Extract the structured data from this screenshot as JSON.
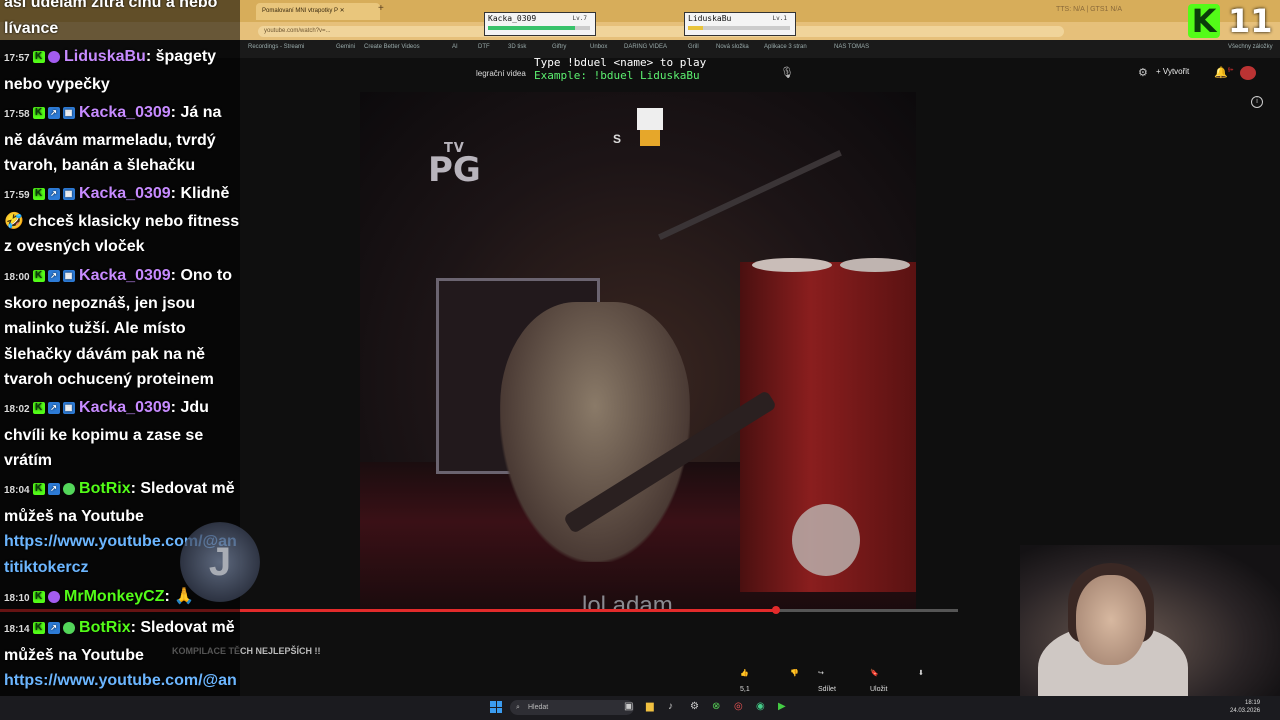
{
  "browser": {
    "active_tab": "Pomalovaní MNI vtrapotky P",
    "url": "youtube.com/watch?v=...",
    "window_status": "TTS: N/A | GTS1 N/A",
    "bookmarks": [
      "Recordings - Streami",
      "Gemini",
      "Create Better Videos",
      "AI",
      "DTF",
      "3D tisk",
      "Giftry",
      "Unbox",
      "DARING VIDEA",
      "Grill",
      "Nová složka",
      "Aplikace 3 stran",
      "NAS TOMAS",
      "Všechny záložky"
    ]
  },
  "youtube": {
    "search_suggestion": "legrační videa",
    "create_label": "Vytvořit",
    "notification_count": "9+",
    "video_title": "KOMPILACE TĚCH NEJLEPŠÍCH !!",
    "like_count": "5,1 tis.",
    "share_label": "Sdílet",
    "save_label": "Uložit",
    "progress": 0.81,
    "watermark": "lol adam",
    "rating_tv": "TV",
    "rating_pg": "PG"
  },
  "duel": {
    "instruction": "Type !bduel <name> to play",
    "example": "Example: !bduel LiduskaBu",
    "players": [
      {
        "name": "Kacka_0309",
        "level": "Lv.7",
        "hp": 0.85,
        "color": "#38c26a"
      },
      {
        "name": "LiduskaBu",
        "level": "Lv.1",
        "hp": 0.15,
        "color": "#e8c33a"
      }
    ],
    "sprite_label": "S"
  },
  "kick": {
    "badge_letter": "K",
    "count": "11"
  },
  "chat": {
    "messages": [
      {
        "ts": "",
        "user": "",
        "text": "asi udělám zítra cînu a nebo lívance"
      },
      {
        "ts": "17:57",
        "user": "LiduskaBu",
        "user_color": "#c78bff",
        "text": ": špagety nebo vypečky"
      },
      {
        "ts": "17:58",
        "user": "Kacka_0309",
        "user_color": "#c78bff",
        "text": ": Já na ně dávám marmeladu, tvrdý tvaroh, banán a šlehačku"
      },
      {
        "ts": "17:59",
        "user": "Kacka_0309",
        "user_color": "#c78bff",
        "text": ": Klidně 🤣 chceš klasicky nebo fitness z ovesných vloček"
      },
      {
        "ts": "18:00",
        "user": "Kacka_0309",
        "user_color": "#c78bff",
        "text": ": Ono to skoro nepoznáš, jen jsou malinko tužší. Ale místo šlehačky dávám pak na ně tvaroh ochucený proteinem"
      },
      {
        "ts": "18:02",
        "user": "Kacka_0309",
        "user_color": "#c78bff",
        "text": ": Jdu chvíli ke kopimu a zase se vrátím"
      },
      {
        "ts": "18:04",
        "user": "BotRix",
        "user_color": "#53fc18",
        "text": ": Sledovat mě můžeš na Youtube",
        "link": "https://www.youtube.com/@antitiktokercz"
      },
      {
        "ts": "18:10",
        "user": "MrMonkeyCZ",
        "user_color": "#53fc18",
        "text": ": 🙏"
      },
      {
        "ts": "18:14",
        "user": "BotRix",
        "user_color": "#53fc18",
        "text": ": Sledovat mě můžeš na Youtube",
        "link": "https://www.youtube.com/@antitiktokercz"
      }
    ],
    "overlay_letter": "J"
  },
  "taskbar": {
    "search_placeholder": "Hledat",
    "time": "18:19",
    "date": "24.03.2026"
  }
}
